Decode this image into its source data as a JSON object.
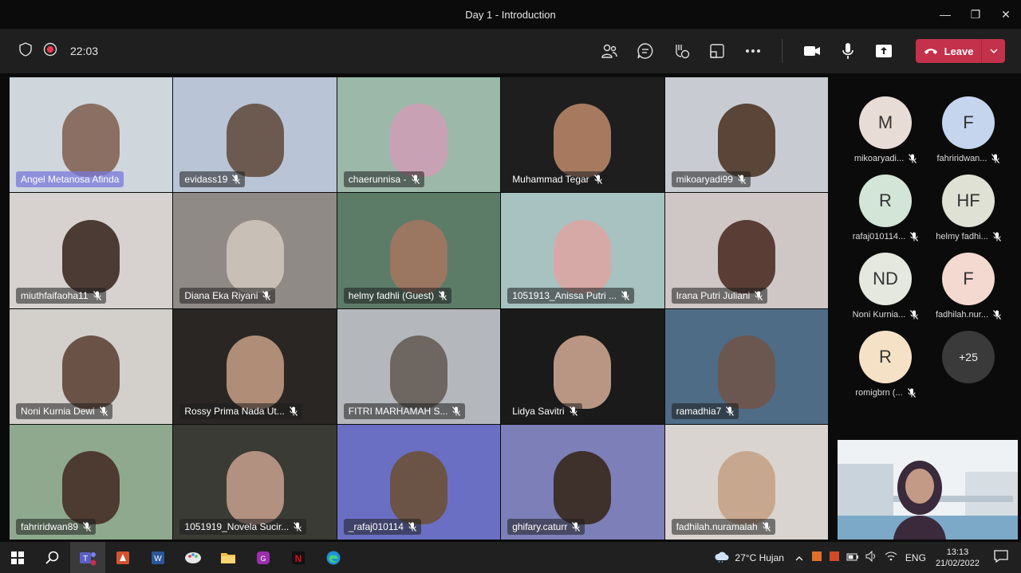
{
  "window": {
    "title": "Day 1 - Introduction"
  },
  "toolbar": {
    "timer": "22:03",
    "leave_label": "Leave"
  },
  "tiles": [
    {
      "label": "Angel Metanosa Afinda",
      "active": true,
      "bg": "#cfd6dc",
      "face": "#8a6f62"
    },
    {
      "label": "evidass19",
      "active": false,
      "bg": "#b9c4d6",
      "face": "#6c5a50"
    },
    {
      "label": "chaerunnisa -",
      "active": false,
      "bg": "#9bb8a8",
      "face": "#c9a1b4"
    },
    {
      "label": "Muhammad Tegar",
      "active": false,
      "bg": "#1e1e1e",
      "face": "#a77a5f"
    },
    {
      "label": "mikoaryadi99",
      "active": false,
      "bg": "#c8ccd2",
      "face": "#5a4538"
    },
    {
      "label": "miuthfaifaoha11",
      "active": false,
      "bg": "#d7d2cf",
      "face": "#4b3b34"
    },
    {
      "label": "Diana Eka Riyani",
      "active": false,
      "bg": "#908a86",
      "face": "#c8c0b6"
    },
    {
      "label": "helmy fadhli (Guest)",
      "active": false,
      "bg": "#5c7c68",
      "face": "#9b7661"
    },
    {
      "label": "1051913_Anissa Putri ...",
      "active": false,
      "bg": "#a7c2c0",
      "face": "#d7a9a6"
    },
    {
      "label": "Irana Putri Juliani",
      "active": false,
      "bg": "#cfc7c5",
      "face": "#5a3e36"
    },
    {
      "label": "Noni Kurnia Dewi",
      "active": false,
      "bg": "#d3cfca",
      "face": "#6a5247"
    },
    {
      "label": "Rossy Prima Nada Ut...",
      "active": false,
      "bg": "#2a2623",
      "face": "#b08d77"
    },
    {
      "label": "FITRI MARHAMAH S...",
      "active": false,
      "bg": "#b4b8bc",
      "face": "#6e6660"
    },
    {
      "label": "Lidya Savitri",
      "active": false,
      "bg": "#1a1a1a",
      "face": "#b99683"
    },
    {
      "label": "ramadhia7",
      "active": false,
      "bg": "#4f6c86",
      "face": "#6c5650"
    },
    {
      "label": "fahriridwan89",
      "active": false,
      "bg": "#8ea98d",
      "face": "#4d3a30"
    },
    {
      "label": "1051919_Novela Sucir...",
      "active": false,
      "bg": "#3b3b35",
      "face": "#b39180"
    },
    {
      "label": "_rafaj010114",
      "active": false,
      "bg": "#6a6fc4",
      "face": "#6b5446"
    },
    {
      "label": "ghifary.caturr",
      "active": false,
      "bg": "#7c7fb8",
      "face": "#3e302b"
    },
    {
      "label": "fadhilah.nuramalah",
      "active": false,
      "bg": "#d9d4cf",
      "face": "#c8a78f"
    }
  ],
  "participants": [
    {
      "initials": "M",
      "name": "mikoaryadi...",
      "color": "#e8dcd6"
    },
    {
      "initials": "F",
      "name": "fahriridwan...",
      "color": "#c6d5ee"
    },
    {
      "initials": "R",
      "name": "rafaj010114...",
      "color": "#d2e5d6"
    },
    {
      "initials": "HF",
      "name": "helmy fadhi...",
      "color": "#dfe1d5"
    },
    {
      "initials": "ND",
      "name": "Noni Kurnia...",
      "color": "#e5e8de"
    },
    {
      "initials": "F",
      "name": "fadhilah.nur...",
      "color": "#f3d9d0"
    },
    {
      "initials": "R",
      "name": "romigbrn (...",
      "color": "#f5e2c6"
    }
  ],
  "more_participants": "+25",
  "taskbar": {
    "weather": "27°C  Hujan",
    "lang": "ENG",
    "time": "13:13",
    "date": "21/02/2022"
  }
}
